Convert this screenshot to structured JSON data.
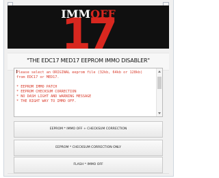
{
  "logo": {
    "line1": "IMMOFF",
    "line2": "17"
  },
  "header": {
    "title": "\"THE EDC17 MED17 EEPROM IMMO DISABLER\""
  },
  "info_box": {
    "text": "Please select an ORIGINAL eeprom file (32kb, 64kb or 128kb)\nfrom EDC17 or MED17.\n\n* EEPROM IMMO PATCH\n* EEPROM CHECKSUM CORRECTION\n* NO DASH LIGHT AND WARNING MESSAGE\n* THE RIGHT WAY TO IMMO OFF."
  },
  "buttons": {
    "immo_off_checksum": "EEPROM * IMMO OFF + CHECKSUM CORRECTION",
    "checksum_only": "EEPROM * CHECKSUM CORRECTION ONLY",
    "flash_immo_off": "FLASH * IMMO OFF"
  },
  "colors": {
    "logo_red": "#d8271f",
    "logo_white": "#ffffff",
    "banner_bg": "#101010",
    "info_text": "#d93a2a"
  }
}
